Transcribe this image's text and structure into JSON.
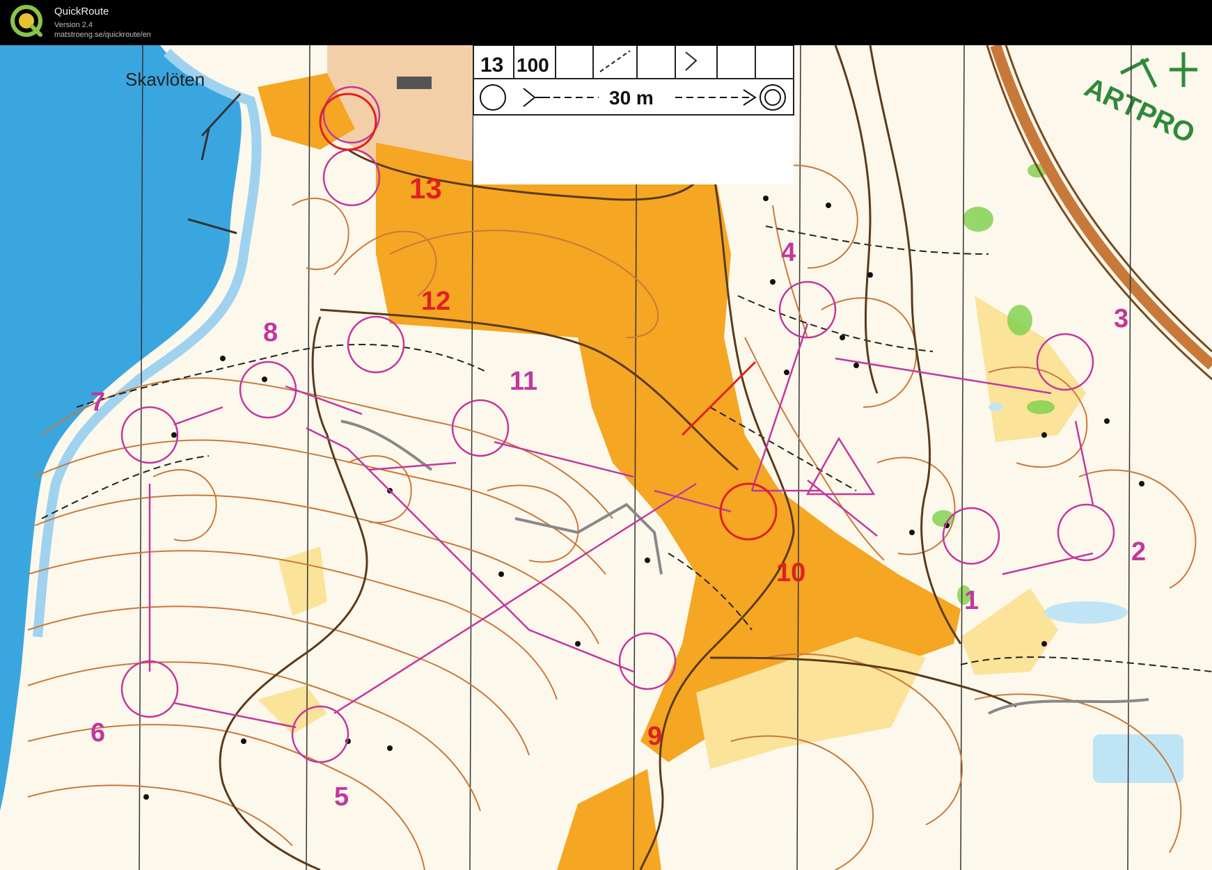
{
  "app": {
    "name": "QuickRoute",
    "version": "Version 2.4",
    "url": "matstroeng.se/quickroute/en"
  },
  "map": {
    "place_name": "Skavlöten",
    "corner_text": "ARTPRO",
    "legend": {
      "course": "13",
      "climb": "100",
      "distance": "30 m"
    },
    "controls": [
      {
        "label": "1"
      },
      {
        "label": "2"
      },
      {
        "label": "3"
      },
      {
        "label": "4"
      },
      {
        "label": "5"
      },
      {
        "label": "6"
      },
      {
        "label": "7"
      },
      {
        "label": "8"
      },
      {
        "label": "9"
      },
      {
        "label": "10"
      },
      {
        "label": "11"
      },
      {
        "label": "12"
      },
      {
        "label": "13"
      }
    ],
    "colors": {
      "water": "#3aa6e0",
      "open_land": "#f5a623",
      "contours": "#c8793a",
      "course": "#c2379e",
      "route": "#e02020",
      "vegetation": "#7ccf4a"
    }
  }
}
